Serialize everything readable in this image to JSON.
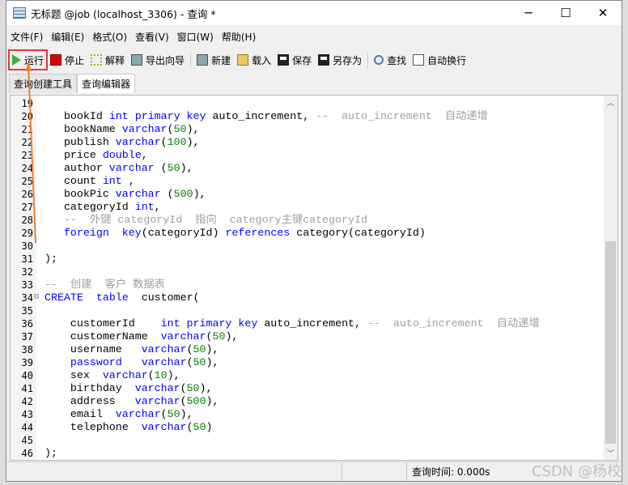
{
  "window": {
    "title": "无标题 @job (localhost_3306) - 查询 *",
    "minimize": "─",
    "maximize": "☐",
    "close": "✕"
  },
  "menu": [
    "文件(F)",
    "编辑(E)",
    "格式(O)",
    "查看(V)",
    "窗口(W)",
    "帮助(H)"
  ],
  "toolbar": {
    "run": "运行",
    "stop": "停止",
    "explain": "解释",
    "export": "导出向导",
    "new": "新建",
    "load": "载入",
    "save": "保存",
    "saveas": "另存为",
    "find": "查找",
    "wrap": "自动换行"
  },
  "tabs": [
    "查询创建工具",
    "查询编辑器"
  ],
  "colors": {
    "keyword": "#0000ff",
    "number": "#008000",
    "comment": "#a0a0a0",
    "highlight": "#e53935",
    "arrow": "#f08030"
  },
  "code": [
    {
      "n": "19",
      "t": []
    },
    {
      "n": "20",
      "t": [
        [
          "tx",
          "   bookId "
        ],
        [
          "kw",
          "int primary key"
        ],
        [
          "tx",
          " auto_increment, "
        ],
        [
          "cm",
          "--  auto_increment  自动递增"
        ]
      ]
    },
    {
      "n": "21",
      "t": [
        [
          "tx",
          "   bookName "
        ],
        [
          "kw",
          "varchar"
        ],
        [
          "tx",
          "("
        ],
        [
          "num",
          "50"
        ],
        [
          "tx",
          "),"
        ]
      ]
    },
    {
      "n": "22",
      "t": [
        [
          "tx",
          "   publish "
        ],
        [
          "kw",
          "varchar"
        ],
        [
          "tx",
          "("
        ],
        [
          "num",
          "100"
        ],
        [
          "tx",
          "),"
        ]
      ]
    },
    {
      "n": "23",
      "t": [
        [
          "tx",
          "   price "
        ],
        [
          "kw",
          "double"
        ],
        [
          "tx",
          ","
        ]
      ]
    },
    {
      "n": "24",
      "t": [
        [
          "tx",
          "   author "
        ],
        [
          "kw",
          "varchar"
        ],
        [
          "tx",
          " ("
        ],
        [
          "num",
          "50"
        ],
        [
          "tx",
          "),"
        ]
      ]
    },
    {
      "n": "25",
      "t": [
        [
          "tx",
          "   count "
        ],
        [
          "kw",
          "int"
        ],
        [
          "tx",
          " ,"
        ]
      ]
    },
    {
      "n": "26",
      "t": [
        [
          "tx",
          "   bookPic "
        ],
        [
          "kw",
          "varchar"
        ],
        [
          "tx",
          " ("
        ],
        [
          "num",
          "500"
        ],
        [
          "tx",
          "),"
        ]
      ]
    },
    {
      "n": "27",
      "t": [
        [
          "tx",
          "   categoryId "
        ],
        [
          "kw",
          "int"
        ],
        [
          "tx",
          ","
        ]
      ]
    },
    {
      "n": "28",
      "t": [
        [
          "cm",
          "   --  外键 categoryId  指向  category主键categoryId"
        ]
      ]
    },
    {
      "n": "29",
      "t": [
        [
          "tx",
          "   "
        ],
        [
          "kw",
          "foreign"
        ],
        [
          "tx",
          "  "
        ],
        [
          "kw",
          "key"
        ],
        [
          "tx",
          "(categoryId) "
        ],
        [
          "kw",
          "references"
        ],
        [
          "tx",
          " category(categoryId)"
        ]
      ]
    },
    {
      "n": "30",
      "t": []
    },
    {
      "n": "31",
      "t": [
        [
          "tx",
          "); "
        ]
      ]
    },
    {
      "n": "32",
      "t": []
    },
    {
      "n": "33",
      "t": [
        [
          "cm",
          "--  创建  客户 数据表"
        ]
      ]
    },
    {
      "n": "34",
      "t": [
        [
          "kw",
          "CREATE"
        ],
        [
          "tx",
          "  "
        ],
        [
          "kw",
          "table"
        ],
        [
          "tx",
          "  customer("
        ]
      ]
    },
    {
      "n": "35",
      "t": []
    },
    {
      "n": "36",
      "t": [
        [
          "tx",
          "    customerId    "
        ],
        [
          "kw",
          "int primary key"
        ],
        [
          "tx",
          " auto_increment, "
        ],
        [
          "cm",
          "--  auto_increment  自动递增"
        ]
      ]
    },
    {
      "n": "37",
      "t": [
        [
          "tx",
          "    customerName  "
        ],
        [
          "kw",
          "varchar"
        ],
        [
          "tx",
          "("
        ],
        [
          "num",
          "50"
        ],
        [
          "tx",
          "),"
        ]
      ]
    },
    {
      "n": "38",
      "t": [
        [
          "tx",
          "    username   "
        ],
        [
          "kw",
          "varchar"
        ],
        [
          "tx",
          "("
        ],
        [
          "num",
          "50"
        ],
        [
          "tx",
          "),"
        ]
      ]
    },
    {
      "n": "39",
      "t": [
        [
          "tx",
          "    "
        ],
        [
          "kw",
          "password"
        ],
        [
          "tx",
          "   "
        ],
        [
          "kw",
          "varchar"
        ],
        [
          "tx",
          "("
        ],
        [
          "num",
          "50"
        ],
        [
          "tx",
          "),"
        ]
      ]
    },
    {
      "n": "40",
      "t": [
        [
          "tx",
          "    sex  "
        ],
        [
          "kw",
          "varchar"
        ],
        [
          "tx",
          "("
        ],
        [
          "num",
          "10"
        ],
        [
          "tx",
          "),"
        ]
      ]
    },
    {
      "n": "41",
      "t": [
        [
          "tx",
          "    birthday  "
        ],
        [
          "kw",
          "varchar"
        ],
        [
          "tx",
          "("
        ],
        [
          "num",
          "50"
        ],
        [
          "tx",
          "),"
        ]
      ]
    },
    {
      "n": "42",
      "t": [
        [
          "tx",
          "    address   "
        ],
        [
          "kw",
          "varchar"
        ],
        [
          "tx",
          "("
        ],
        [
          "num",
          "500"
        ],
        [
          "tx",
          "),"
        ]
      ]
    },
    {
      "n": "43",
      "t": [
        [
          "tx",
          "    email  "
        ],
        [
          "kw",
          "varchar"
        ],
        [
          "tx",
          "("
        ],
        [
          "num",
          "50"
        ],
        [
          "tx",
          "),"
        ]
      ]
    },
    {
      "n": "44",
      "t": [
        [
          "tx",
          "    telephone  "
        ],
        [
          "kw",
          "varchar"
        ],
        [
          "tx",
          "("
        ],
        [
          "num",
          "50"
        ],
        [
          "tx",
          ")"
        ]
      ]
    },
    {
      "n": "45",
      "t": []
    },
    {
      "n": "46",
      "t": [
        [
          "tx",
          ");"
        ]
      ]
    }
  ],
  "status": {
    "query_time": "查询时间: 0.000s"
  },
  "watermark": "CSDN @杨校"
}
